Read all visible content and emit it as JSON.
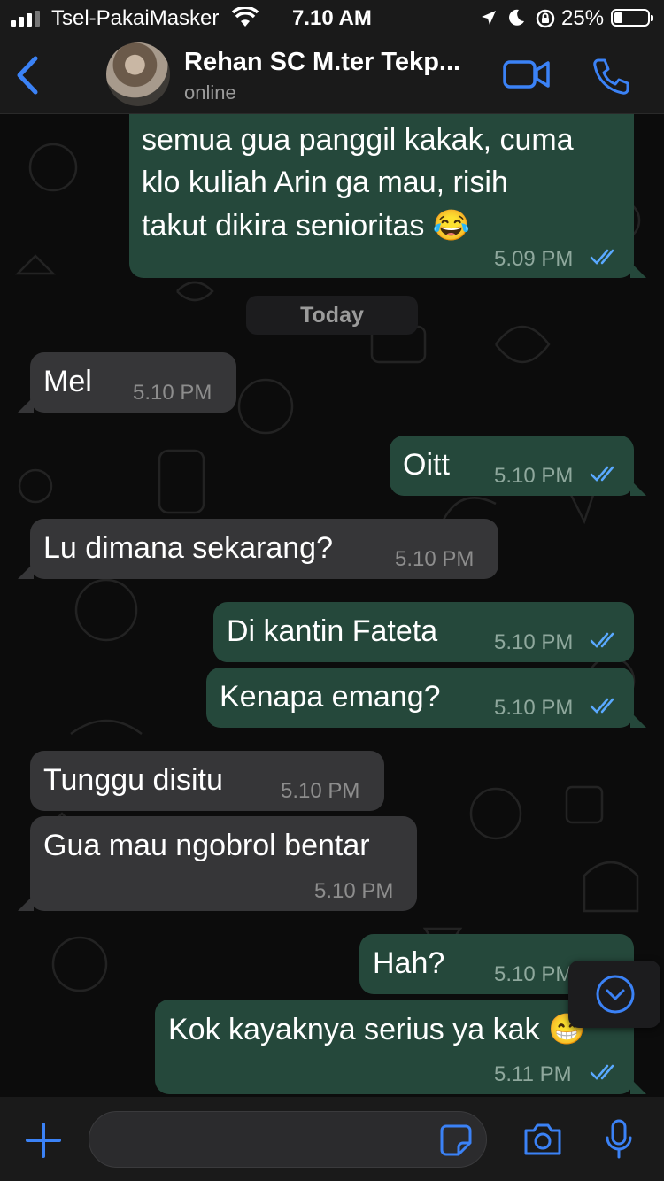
{
  "status_bar": {
    "carrier": "Tsel-PakaiMasker",
    "time": "7.10 AM",
    "battery": "25%"
  },
  "header": {
    "contact_name": "Rehan SC M.ter Tekp...",
    "status": "online"
  },
  "chat": {
    "day_label": "Today",
    "messages": [
      {
        "dir": "out",
        "lines": [
          "semua gua panggil kakak, cuma",
          "klo kuliah Arin ga mau, risih",
          "takut dikira senioritas 😂"
        ],
        "time": "5.09 PM"
      },
      {
        "dir": "in",
        "text": "Mel",
        "time": "5.10 PM"
      },
      {
        "dir": "out",
        "text": "Oitt",
        "time": "5.10 PM"
      },
      {
        "dir": "in",
        "text": "Lu dimana sekarang?",
        "time": "5.10 PM"
      },
      {
        "dir": "out",
        "text": "Di kantin Fateta",
        "time": "5.10 PM"
      },
      {
        "dir": "out",
        "text": "Kenapa emang?",
        "time": "5.10 PM"
      },
      {
        "dir": "in",
        "text": "Tunggu disitu",
        "time": "5.10 PM"
      },
      {
        "dir": "in",
        "text": "Gua mau ngobrol bentar",
        "time": "5.10 PM"
      },
      {
        "dir": "out",
        "text": "Hah?",
        "time": "5.10 PM"
      },
      {
        "dir": "out",
        "text": "Kok kayaknya serius ya kak 😁",
        "time": "5.11 PM"
      }
    ]
  },
  "input": {
    "placeholder": ""
  },
  "colors": {
    "accent": "#3b82f6",
    "bubble_out": "#25483b",
    "bubble_in": "#363638",
    "read_tick": "#5aa9ff"
  }
}
